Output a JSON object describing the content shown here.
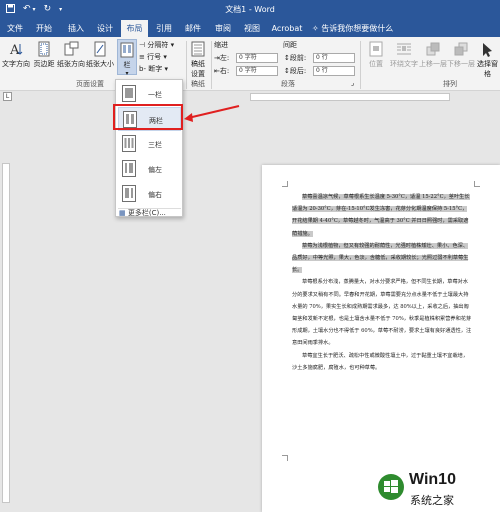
{
  "app": {
    "title": "文档1 - Word",
    "colors": {
      "titlebar": "#2b579a",
      "ribbon": "#f3f3f3",
      "highlight_red": "#e02020",
      "text_highlight": "#c9c9c9"
    }
  },
  "qat": {
    "save_icon": "save-icon",
    "undo_glyph": "↶",
    "redo_glyph": "↻",
    "more_glyph": "▾"
  },
  "tabs": [
    "文件",
    "开始",
    "插入",
    "设计",
    "布局",
    "引用",
    "邮件",
    "审阅",
    "视图",
    "Acrobat"
  ],
  "active_tab": "布局",
  "tell_me": "告诉我你想要做什么",
  "ribbon": {
    "text_direction": "文字方向",
    "margins": "页边距",
    "orientation": "纸张方向",
    "size": "纸张大小",
    "columns": "栏",
    "breaks": "分隔符",
    "line_numbers": "行号",
    "hyphenation": "断字",
    "page_setup_group": "页面设置",
    "draft": [
      "稿纸",
      "设置"
    ],
    "draft_group": "稿纸",
    "indent_label": "缩进",
    "spacing_label": "间距",
    "indent_left_label": "左:",
    "indent_left_value": "0 字符",
    "indent_right_label": "右:",
    "indent_right_value": "0 字符",
    "space_before_label": "段前:",
    "space_before_value": "0 行",
    "space_after_label": "段后:",
    "space_after_value": "0 行",
    "paragraph_group": "段落",
    "position": "位置",
    "wrap_text": "环绕文字",
    "bring_forward": "上移一层",
    "send_backward": "下移一层",
    "selection_pane": "选择窗格",
    "arrange_group": "排列"
  },
  "columns_menu": {
    "items": [
      "一栏",
      "两栏",
      "三栏",
      "偏左",
      "偏右"
    ],
    "selected": "两栏",
    "more": "更多栏(C)..."
  },
  "document": {
    "paragraphs": [
      "草莓喜温凉气候，草莓根系生长温度 5-30°C，适温 15-22°C，茎叶生长适温为 20-30°C，芽在-15-10°C发生冻害，花芽分化期温度保持 5-15°C，开花结果期 4-40°C，草莓越冬时，气温高于 30°C 并日日照强时，需采取遮荫措施。",
      "草莓为浅根植物，但又有较强的耐荫性，光强时植株矮壮、果小、色深、品质好，中等光照，果大，色淡，含糖低，采收期较长；光照过弱不利草莓生长。",
      "草莓根系分布浅，蒸腾量大，对水分要求严格，但不同生长期，草莓对水分的要求又稍有不同。早春和开花期，草莓需要充分点水量不低于土壤最大持水量的 70%，果实生长和成熟期需求最多，达 80%以上，采收之后，抽出匍匐茎和发新不定根，也是土壤含水量不低于 70%，秋季是植株积累营养和花芽形成期，土壤水分也不得低于 60%，草莓不耐涝，要求土壤有良好通透性，注意田间雨季排水。",
      "草莓宜生长于肥沃、疏松中性或微酸性壤土中，过于黏重土壤不宜栽培，沙土多施腐肥，腐殖水，也可种草莓。"
    ]
  },
  "watermark": {
    "brand": "Win10",
    "sub": "系统之家"
  }
}
